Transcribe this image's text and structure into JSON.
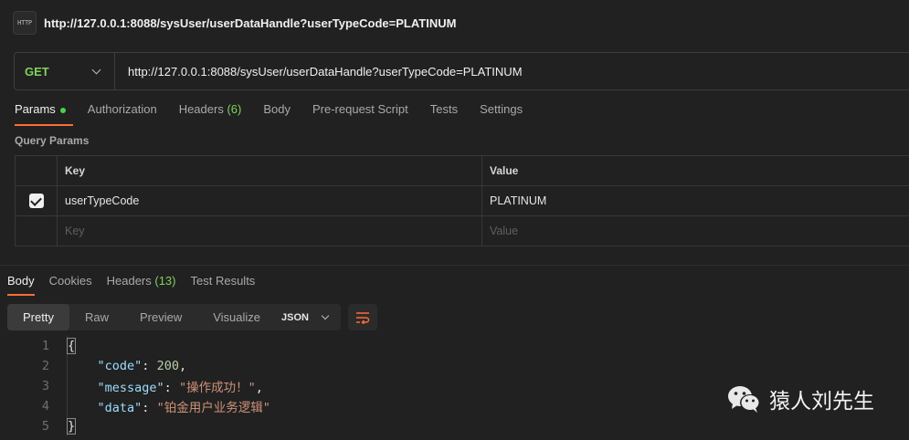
{
  "request": {
    "title": "http://127.0.0.1:8088/sysUser/userDataHandle?userTypeCode=PLATINUM",
    "icon_text": "HTTP",
    "method": "GET",
    "url": "http://127.0.0.1:8088/sysUser/userDataHandle?userTypeCode=PLATINUM"
  },
  "request_tabs": {
    "params": "Params",
    "authorization": "Authorization",
    "headers": "Headers",
    "headers_count": "(6)",
    "body": "Body",
    "pre_request": "Pre-request Script",
    "tests": "Tests",
    "settings": "Settings"
  },
  "query_params": {
    "label": "Query Params",
    "key_header": "Key",
    "value_header": "Value",
    "rows": [
      {
        "checked": true,
        "key": "userTypeCode",
        "value": "PLATINUM"
      }
    ],
    "key_placeholder": "Key",
    "value_placeholder": "Value"
  },
  "response_tabs": {
    "body": "Body",
    "cookies": "Cookies",
    "headers": "Headers",
    "headers_count": "(13)",
    "test_results": "Test Results"
  },
  "view": {
    "pretty": "Pretty",
    "raw": "Raw",
    "preview": "Preview",
    "visualize": "Visualize",
    "format": "JSON"
  },
  "response_body": {
    "line_numbers": [
      "1",
      "2",
      "3",
      "4",
      "5"
    ],
    "open_brace": "{",
    "close_brace": "}",
    "code_key": "\"code\"",
    "code_value": "200",
    "message_key": "\"message\"",
    "message_value": "\"操作成功！\"",
    "data_key": "\"data\"",
    "data_value": "\"铂金用户业务逻辑\""
  },
  "watermark": {
    "text": "猿人刘先生"
  },
  "colors": {
    "accent": "#ff6c37",
    "method_get": "#7fd35c",
    "json_key": "#9cdcfe",
    "json_number": "#b5cea8",
    "json_string": "#ce9178"
  }
}
